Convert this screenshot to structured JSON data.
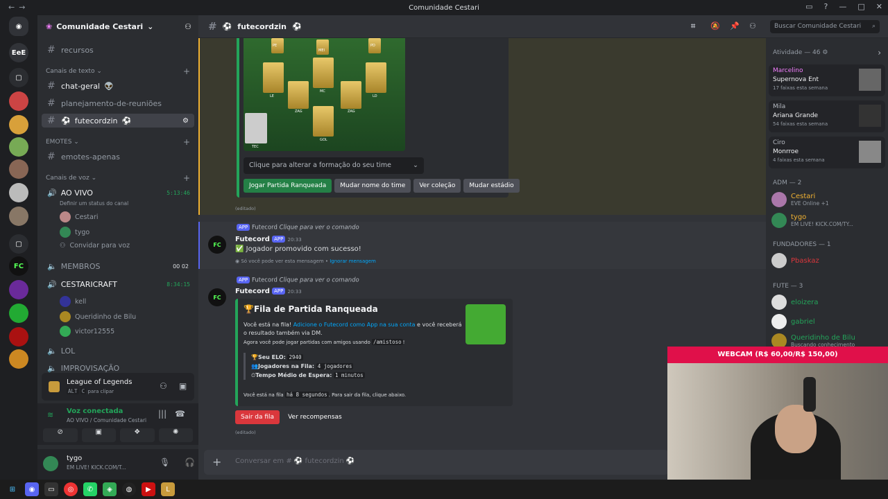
{
  "window": {
    "title": "Comunidade Cestari"
  },
  "servers": [
    "EeE",
    "FC"
  ],
  "guild": {
    "name": "Comunidade Cestari"
  },
  "channels": {
    "recursos": "recursos",
    "cat_text": "Canais de texto",
    "chat_geral": "chat-geral",
    "planejamento": "planejamento-de-reuniões",
    "futecordzin": "futecordzin",
    "cat_emotes": "EMOTES",
    "emotes_apenas": "emotes-apenas",
    "cat_voice": "Canais de voz",
    "ao_vivo": "AO VIVO",
    "ao_vivo_time": "5:13:46",
    "ao_vivo_status": "Definir um status do canal",
    "cestari": "Cestari",
    "tygo": "tygo",
    "convidar": "Convidar para voz",
    "membros": "MEMBROS",
    "membros_count_a": "00",
    "membros_count_b": "02",
    "cestaricraft": "CESTARICRAFT",
    "cestaricraft_time": "8:34:15",
    "kell": "kell",
    "bilu": "Queridinho de Bilu",
    "victor": "victor12555",
    "lol": "LOL",
    "improvisacao": "IMPROVISAÇÃO"
  },
  "lol_panel": {
    "title": "League of Legends",
    "key_a": "ALT",
    "key_b": "C",
    "hint": "para clipar"
  },
  "voice_panel": {
    "status": "Voz conectada",
    "where": "AO VIVO / Comunidade Cestari"
  },
  "user_panel": {
    "name": "tygo",
    "status": "EM LIVE! KICK.COM/T..."
  },
  "header": {
    "channel": "futecordzin",
    "search_placeholder": "Buscar Comunidade Cestari"
  },
  "messages": {
    "select": "Clique para alterar a formação do seu time",
    "b1": "Jogar Partida Ranqueada",
    "b2": "Mudar nome do time",
    "b3": "Ver coleção",
    "b4": "Mudar estádio",
    "edited": "(editado)",
    "app": "APP",
    "bot": "Futecord",
    "cmd": "Clique para ver o comando",
    "t1": "20:33",
    "promo": "Jogador promovido com sucesso!",
    "only": "Só você pode ver esta mensagem •",
    "ignore": "Ignorar mensagem",
    "t2": "20:33",
    "queue_title": "Fila de Partida Ranqueada",
    "queue_text1": "Você está na fila!",
    "queue_link": "Adicione o Futecord como App na sua conta",
    "queue_text2": "e você receberá o resultado também via DM.",
    "queue_text3": "Agora você pode jogar partidas com amigos usando",
    "queue_cmd": "/amistoso",
    "elo_label": "Seu ELO:",
    "elo_val": "2940",
    "players_label": "Jogadores na Fila:",
    "players_val": "4 jogadores",
    "wait_label": "Tempo Médio de Espera:",
    "wait_val": "1 minutos",
    "queue_foot_a": "Você está na fila",
    "queue_foot_code": "há 8 segundos",
    "queue_foot_b": ". Para sair da fila, clique abaixo.",
    "leave": "Sair da fila",
    "rewards": "Ver recompensas",
    "input_placeholder": "Conversar em # ⚽ futecordzin ⚽"
  },
  "formation": {
    "labels": [
      "PE",
      "MEI",
      "PD",
      "LE",
      "MC",
      "LD",
      "ZAG",
      "ZAG",
      "GOL",
      "TEC"
    ]
  },
  "members": {
    "activity": "Atividade — 46",
    "a1_name": "Marcelino",
    "a1_sub": "Supernova Ent",
    "a1_sub2": "17 faixas esta semana",
    "a2_name": "Mila",
    "a2_sub": "Ariana Grande",
    "a2_sub2": "54 faixas esta semana",
    "a3_name": "Ciro",
    "a3_sub": "Monrroe",
    "a3_sub2": "4 faixas esta semana",
    "adm": "ADM — 2",
    "m1": "Cestari",
    "m1_sub": "EVE Online +1",
    "m2": "tygo",
    "m2_sub": "EM LIVE! KICK.COM/TY...",
    "fund": "FUNDADORES — 1",
    "m3": "Pbaskaz",
    "fute": "FUTE — 3",
    "m4": "eloizera",
    "m5": "gabriel",
    "m6": "Queridinho de Bilu",
    "m6_sub": "Buscando conhecimento"
  },
  "webcam": {
    "label": "WEBCAM (R$ 60,00/R$ 150,00)"
  },
  "colors": {
    "green": "#23a55a",
    "blurple": "#5865f2",
    "red": "#da373c",
    "webcam": "#e0104a"
  }
}
